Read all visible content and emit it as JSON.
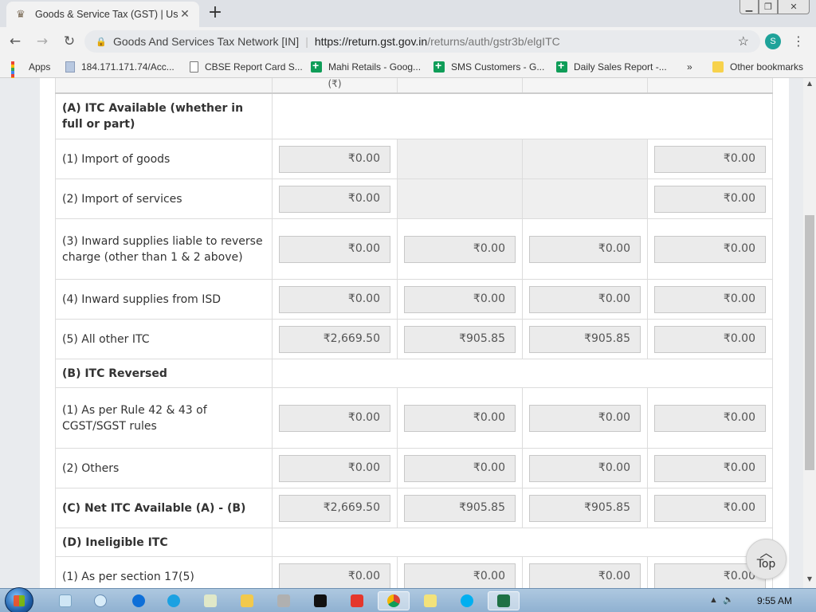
{
  "browser": {
    "tab_title": "Goods & Service Tax (GST) | User",
    "new_tab_symbol": "+",
    "site_name": "Goods And Services Tax Network [IN]",
    "url_scheme_host": "https://return.gst.gov.in",
    "url_path": "/returns/auth/gstr3b/elgITC",
    "profile_initial": "S"
  },
  "bookmarks": [
    {
      "label": "Apps",
      "icon": "apps-grid-icon"
    },
    {
      "label": "184.171.171.74/Acc...",
      "icon": "page-icon"
    },
    {
      "label": "CBSE Report Card S...",
      "icon": "doc-icon"
    },
    {
      "label": "Mahi Retails - Goog...",
      "icon": "sheet-icon"
    },
    {
      "label": "SMS Customers - G...",
      "icon": "sheet-icon"
    },
    {
      "label": "Daily Sales Report -...",
      "icon": "sheet-icon"
    }
  ],
  "bookmarks_overflow": "»",
  "other_bookmarks": "Other bookmarks",
  "table": {
    "header_fragment": "(₹)",
    "rows": [
      {
        "label": "(A) ITC Available (whether in full or part)",
        "section": true
      },
      {
        "label": "(1) Import of goods",
        "values": [
          "₹0.00",
          null,
          null,
          "₹0.00"
        ]
      },
      {
        "label": "(2) Import of services",
        "values": [
          "₹0.00",
          null,
          null,
          "₹0.00"
        ]
      },
      {
        "label": "(3) Inward supplies liable to reverse charge (other than 1 & 2 above)",
        "values": [
          "₹0.00",
          "₹0.00",
          "₹0.00",
          "₹0.00"
        ]
      },
      {
        "label": "(4) Inward supplies from ISD",
        "values": [
          "₹0.00",
          "₹0.00",
          "₹0.00",
          "₹0.00"
        ]
      },
      {
        "label": "(5) All other ITC",
        "values": [
          "₹2,669.50",
          "₹905.85",
          "₹905.85",
          "₹0.00"
        ]
      },
      {
        "label": "(B) ITC Reversed",
        "section": true
      },
      {
        "label": "(1) As per Rule 42 & 43 of CGST/SGST rules",
        "values": [
          "₹0.00",
          "₹0.00",
          "₹0.00",
          "₹0.00"
        ]
      },
      {
        "label": "(2) Others",
        "values": [
          "₹0.00",
          "₹0.00",
          "₹0.00",
          "₹0.00"
        ]
      },
      {
        "label": "(C) Net ITC Available (A) - (B)",
        "values": [
          "₹2,669.50",
          "₹905.85",
          "₹905.85",
          "₹0.00"
        ],
        "bold": true
      },
      {
        "label": "(D) Ineligible ITC",
        "section": true
      },
      {
        "label": "(1) As per section 17(5)",
        "values": [
          "₹0.00",
          "₹0.00",
          "₹0.00",
          "₹0.00"
        ]
      }
    ]
  },
  "top_button_label": "Top",
  "taskbar": {
    "clock": "9:55 AM"
  }
}
